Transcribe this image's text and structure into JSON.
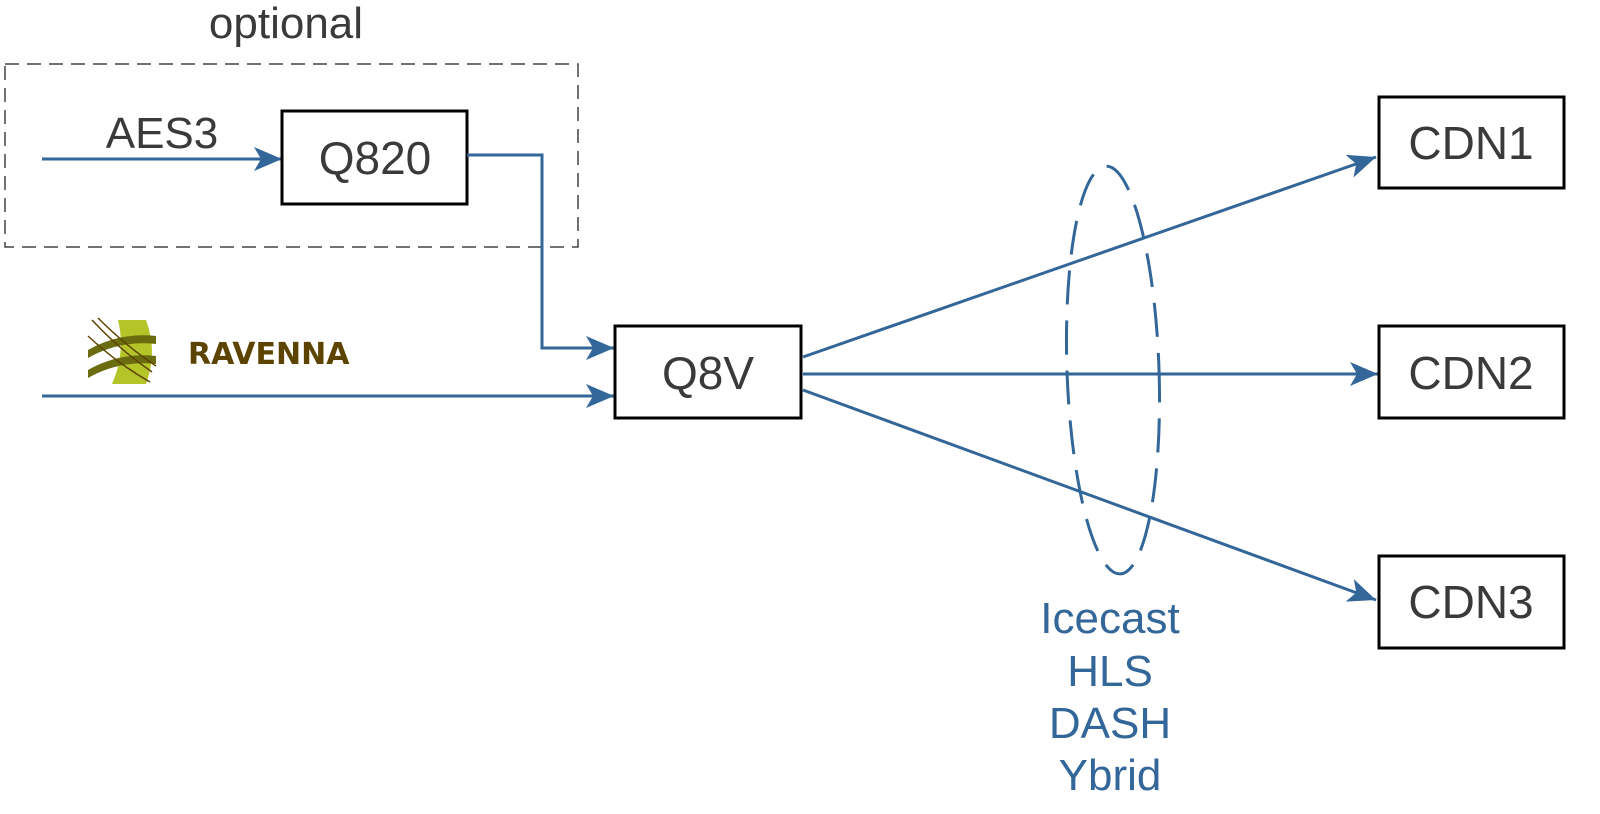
{
  "diagram": {
    "optional_label": "optional",
    "input_label": "AES3",
    "nodes": {
      "q820": "Q820",
      "q8v": "Q8V",
      "cdn1": "CDN1",
      "cdn2": "CDN2",
      "cdn3": "CDN3"
    },
    "ravenna_logo_text": "RAVENNA",
    "protocols": [
      "Icecast",
      "HLS",
      "DASH",
      "Ybrid"
    ],
    "colors": {
      "arrow": "#336699",
      "box_border": "#000000",
      "text": "#3a3a3a",
      "ravenna_text": "#5c4400",
      "ravenna_green": "#b5c429",
      "ravenna_dark_green": "#6b6b10"
    }
  }
}
